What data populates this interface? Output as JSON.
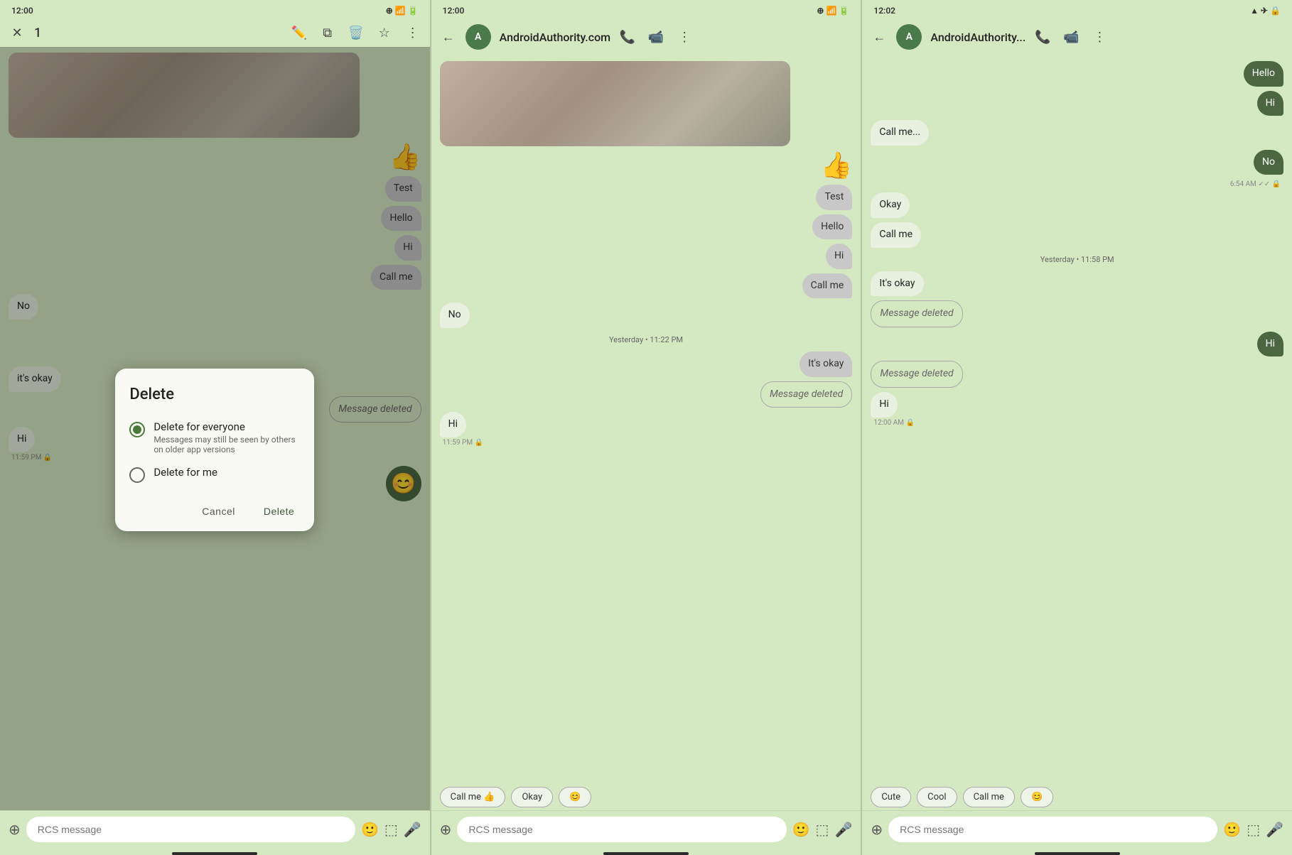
{
  "screen1": {
    "status_time": "12:00",
    "toolbar": {
      "count": "1",
      "icons": [
        "edit",
        "copy",
        "delete",
        "star",
        "more"
      ]
    },
    "messages": [
      {
        "type": "image",
        "side": "left"
      },
      {
        "type": "emoji",
        "content": "👍",
        "side": "right"
      },
      {
        "type": "bubble",
        "text": "Test",
        "side": "right",
        "style": "gray"
      },
      {
        "type": "bubble",
        "text": "Hello",
        "side": "right",
        "style": "gray"
      },
      {
        "type": "bubble",
        "text": "Hi",
        "side": "right",
        "style": "gray"
      },
      {
        "type": "bubble",
        "text": "Call me",
        "side": "right",
        "style": "gray"
      },
      {
        "type": "bubble",
        "text": "No",
        "side": "left",
        "style": "received"
      },
      {
        "type": "bubble",
        "text": "it's okay",
        "side": "left",
        "style": "received"
      },
      {
        "type": "bubble",
        "text": "Message deleted",
        "side": "right",
        "style": "deleted"
      },
      {
        "type": "bubble",
        "text": "Hi",
        "side": "left",
        "style": "received"
      },
      {
        "type": "timestamp_under",
        "text": "11:59 PM 🔒"
      },
      {
        "type": "emoji",
        "content": "😊",
        "side": "right"
      }
    ],
    "dialog": {
      "title": "Delete",
      "option1": {
        "label": "Delete for everyone",
        "sublabel": "Messages may still be seen by others on older app versions",
        "selected": true
      },
      "option2": {
        "label": "Delete for me",
        "selected": false
      },
      "cancel": "Cancel",
      "confirm": "Delete"
    },
    "input": {
      "placeholder": "RCS message"
    }
  },
  "screen2": {
    "status_time": "12:00",
    "contact": "AndroidAuthority.com",
    "messages": [
      {
        "type": "image",
        "side": "left"
      },
      {
        "type": "emoji",
        "content": "👍",
        "side": "right"
      },
      {
        "type": "bubble",
        "text": "Test",
        "side": "right",
        "style": "gray"
      },
      {
        "type": "bubble",
        "text": "Hello",
        "side": "right",
        "style": "gray"
      },
      {
        "type": "bubble",
        "text": "Hi",
        "side": "right",
        "style": "gray"
      },
      {
        "type": "bubble",
        "text": "Call me",
        "side": "right",
        "style": "gray"
      },
      {
        "type": "bubble",
        "text": "No",
        "side": "left",
        "style": "received"
      },
      {
        "type": "timestamp",
        "text": "Yesterday • 11:22 PM"
      },
      {
        "type": "bubble",
        "text": "It's okay",
        "side": "right",
        "style": "gray"
      },
      {
        "type": "bubble",
        "text": "Message deleted",
        "side": "right",
        "style": "deleted-right"
      },
      {
        "type": "bubble",
        "text": "Hi",
        "side": "left",
        "style": "received"
      },
      {
        "type": "timestamp_under",
        "text": "11:59 PM 🔒"
      }
    ],
    "quick_replies": [
      "Call me 👍",
      "Okay",
      "😊"
    ],
    "input": {
      "placeholder": "RCS message"
    }
  },
  "screen3": {
    "status_time": "12:02",
    "contact": "AndroidAuthority...",
    "messages": [
      {
        "type": "bubble",
        "text": "Hello",
        "side": "right",
        "style": "sent"
      },
      {
        "type": "bubble",
        "text": "Hi",
        "side": "right",
        "style": "sent"
      },
      {
        "type": "bubble",
        "text": "Call me...",
        "side": "left",
        "style": "received"
      },
      {
        "type": "bubble",
        "text": "No",
        "side": "right",
        "style": "sent"
      },
      {
        "type": "timestamp_under",
        "text": "6:54 AM ✓✓ 🔒"
      },
      {
        "type": "bubble",
        "text": "Okay",
        "side": "left",
        "style": "received"
      },
      {
        "type": "bubble",
        "text": "Call me",
        "side": "left",
        "style": "received"
      },
      {
        "type": "timestamp",
        "text": "Yesterday • 11:58 PM"
      },
      {
        "type": "bubble",
        "text": "It's okay",
        "side": "left",
        "style": "received"
      },
      {
        "type": "bubble",
        "text": "Message deleted",
        "side": "left",
        "style": "deleted"
      },
      {
        "type": "bubble",
        "text": "Hi",
        "side": "right",
        "style": "sent"
      },
      {
        "type": "bubble",
        "text": "Message deleted",
        "side": "left",
        "style": "deleted"
      },
      {
        "type": "bubble",
        "text": "Hi",
        "side": "left",
        "style": "received"
      },
      {
        "type": "timestamp_under",
        "text": "12:00 AM 🔒"
      }
    ],
    "quick_replies": [
      "Cute",
      "Cool",
      "Call me",
      "😊"
    ],
    "input": {
      "placeholder": "RCS message"
    }
  }
}
